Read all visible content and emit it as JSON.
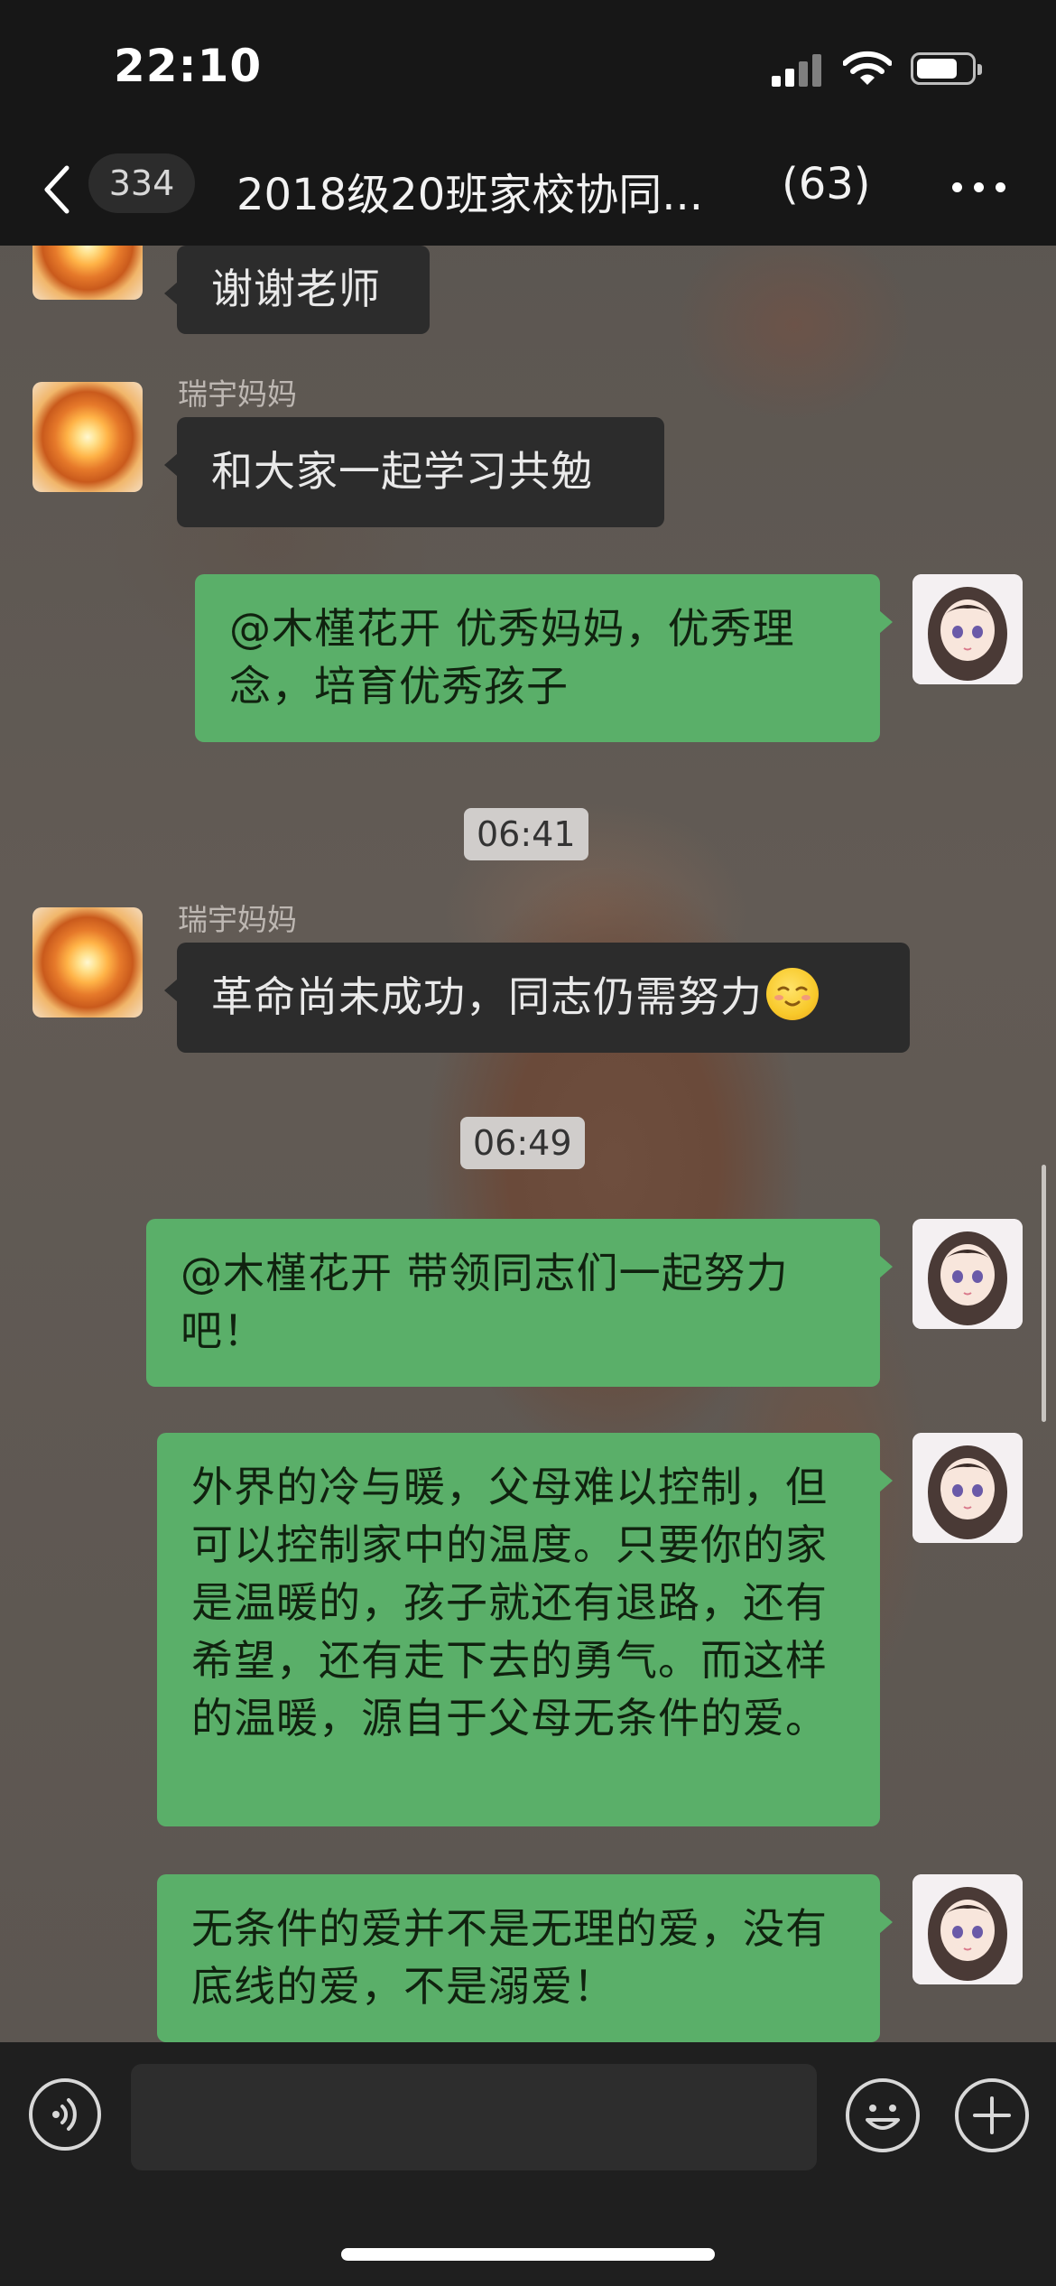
{
  "status_bar": {
    "time": "22:10"
  },
  "nav": {
    "unread_count": "334",
    "title": "2018级20班家校协同...",
    "member_count": "(63)"
  },
  "messages": [
    {
      "side": "left",
      "text": "谢谢老师"
    },
    {
      "side": "left",
      "sender": "瑞宇妈妈",
      "text": "和大家一起学习共勉"
    },
    {
      "side": "right",
      "text": "@木槿花开 优秀妈妈，优秀理念，培育优秀孩子"
    },
    {
      "type": "time",
      "text": "06:41"
    },
    {
      "side": "left",
      "sender": "瑞宇妈妈",
      "text": "革命尚未成功，同志仍需努力",
      "emoji": "smile-emoji"
    },
    {
      "type": "time",
      "text": "06:49"
    },
    {
      "side": "right",
      "text": "@木槿花开 带领同志们一起努力吧！"
    },
    {
      "side": "right",
      "text": "外界的冷与暖，父母难以控制，但可以控制家中的温度。只要你的家是温暖的，孩子就还有退路，还有希望，还有走下去的勇气。而这样的温暖，源自于父母无条件的爱。"
    },
    {
      "side": "right",
      "text": "无条件的爱并不是无理的爱，没有底线的爱，不是溺爱！"
    }
  ],
  "icons": {
    "back": "chevron-left-icon",
    "more": "more-dots-icon",
    "voice": "voice-icon",
    "emoji": "emoji-icon",
    "plus": "plus-icon"
  },
  "colors": {
    "bubble_self": "#5aaf69",
    "bubble_other": "#2c2c2c",
    "bar_background": "#171717"
  }
}
